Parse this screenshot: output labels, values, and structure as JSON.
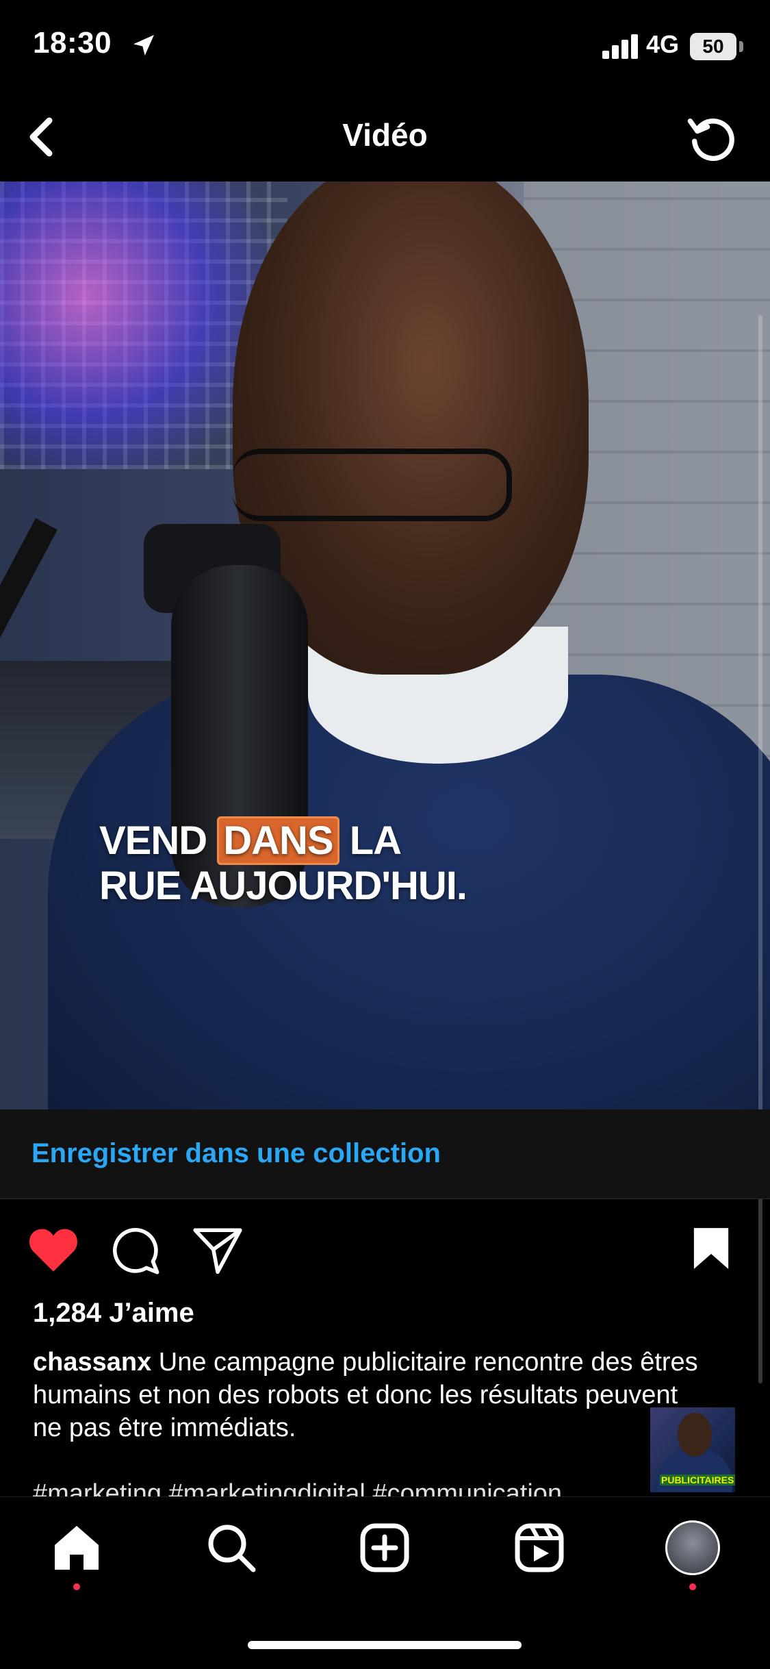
{
  "status_bar": {
    "time": "18:30",
    "network": "4G",
    "battery": "50"
  },
  "header": {
    "title": "Vidéo"
  },
  "video": {
    "caption_line1_before": "VEND ",
    "caption_highlight": "DANS",
    "caption_line1_after": " LA",
    "caption_line2": "RUE AUJOURD'HUI."
  },
  "collection": {
    "link_label": "Enregistrer dans une collection"
  },
  "post": {
    "likes": "1,284 J’aime",
    "username": "chassanx",
    "caption_text": " Une campagne publicitaire rencontre des êtres humains et non des robots et donc les résultats peuvent ne pas être immédiats.",
    "hashtags": "#marketing #marketingdigital #communication"
  },
  "thumbnail": {
    "label": "PUBLICITAIRES"
  },
  "colors": {
    "accent_link": "#2aa7f5",
    "like_red": "#ff3040",
    "highlight_orange": "#d9662c"
  },
  "tab_bar": {
    "items": [
      {
        "name": "home",
        "icon": "home-icon"
      },
      {
        "name": "search",
        "icon": "search-icon"
      },
      {
        "name": "create",
        "icon": "plus-square-icon"
      },
      {
        "name": "reels",
        "icon": "reels-icon"
      },
      {
        "name": "profile",
        "icon": "avatar"
      }
    ]
  }
}
